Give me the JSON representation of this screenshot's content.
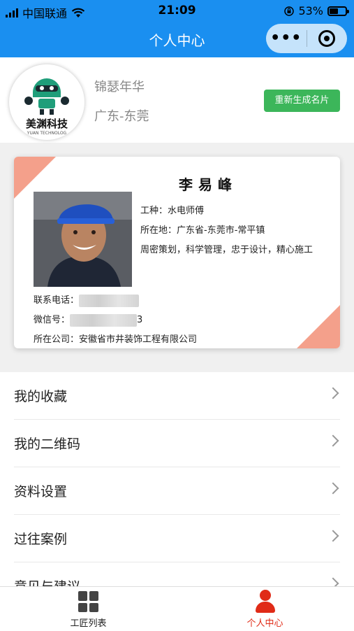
{
  "status": {
    "carrier": "中国联通",
    "time": "21:09",
    "battery": "53%"
  },
  "nav": {
    "title": "个人中心",
    "more_icon": "more-dots-icon",
    "close_icon": "target-icon"
  },
  "profile": {
    "brand": "美渊科技",
    "brand_sub": "YUAN TECHNOLOG",
    "nickname": "锦瑟年华",
    "region": "广东-东莞",
    "regen_label": "重新生成名片",
    "regen_color": "#3cb65a"
  },
  "card": {
    "name": "李易峰",
    "trade": "工种：水电师傅",
    "location": "所在地：广东省-东莞市-常平镇",
    "motto": "周密策划，科学管理，忠于设计，精心施工",
    "phone_label": "联系电话：",
    "wechat_label": "微信号：",
    "wechat_tail": "3",
    "company": "所在公司：安徽省市井装饰工程有限公司",
    "accent_color": "#f4a08b"
  },
  "menu": {
    "items": [
      {
        "label": "我的收藏"
      },
      {
        "label": "我的二维码"
      },
      {
        "label": "资料设置"
      },
      {
        "label": "过往案例"
      },
      {
        "label": "意见与建议"
      }
    ]
  },
  "tabbar": {
    "tabs": [
      {
        "label": "工匠列表",
        "icon": "grid-icon",
        "color": "#222222"
      },
      {
        "label": "个人中心",
        "icon": "person-icon",
        "color": "#e02b17"
      }
    ]
  }
}
